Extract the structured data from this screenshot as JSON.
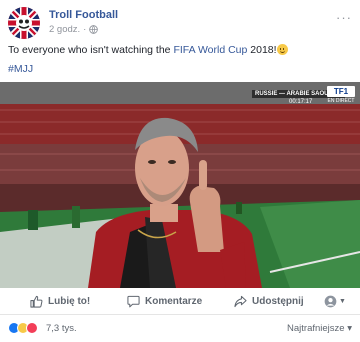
{
  "post": {
    "page_name": "Troll Football",
    "time": "2 godz.",
    "separator": "·",
    "text_before": "To everyone who isn't watching the ",
    "text_link": "FIFA World Cup",
    "text_after": " 2018!",
    "hashtag": "#MJJ"
  },
  "video": {
    "score_label": "RUSSIE — ARABIE SAOUDITE",
    "time_label": "00:17:17",
    "channel_logo": "TF1",
    "live_label": "EN DIRECT"
  },
  "actions": {
    "like_label": "Lubię to!",
    "comment_label": "Komentarze",
    "share_label": "Udostępnij"
  },
  "summary": {
    "reaction_count": "7,3 tys.",
    "sort_label": "Najtrafniejsze",
    "sort_caret": "▾"
  },
  "colors": {
    "link": "#365899",
    "secondary_text": "#90949c",
    "like_blue": "#1877f2"
  }
}
